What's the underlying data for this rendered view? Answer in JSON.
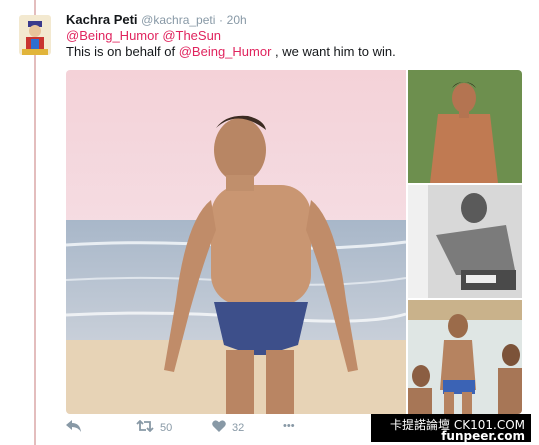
{
  "tweet": {
    "display_name": "Kachra Peti",
    "handle": "@kachra_peti",
    "separator": "·",
    "time": "20h",
    "reply_mentions": [
      "@Being_Humor",
      "@TheSun"
    ],
    "text_before": "This is on behalf of ",
    "text_mention": "@Being_Humor",
    "text_after": " , we want him to win."
  },
  "actions": {
    "retweet_count": "50",
    "like_count": "32",
    "more_label": "•••"
  },
  "media": {
    "main_image": "man-in-swim-trunks-on-beach-photo",
    "thumbnails": [
      "shirtless-man-green-background-photo",
      "black-and-white-shirtless-man-photo",
      "group-of-men-in-swimwear-photo"
    ]
  },
  "watermark": {
    "line1": "卡提諾論壇 CK101.COM",
    "line2": "funpeer.com"
  },
  "colors": {
    "link": "#e0245e",
    "thread_line": "#e3bdbd",
    "secondary_text": "#8899a6"
  }
}
